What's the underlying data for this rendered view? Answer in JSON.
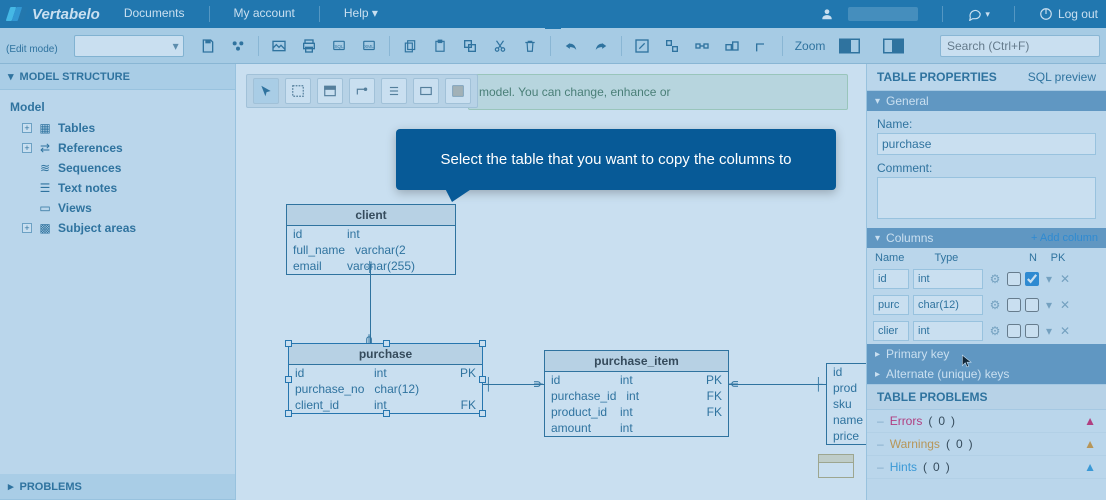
{
  "app": {
    "name": "Vertabelo"
  },
  "topnav": {
    "links": [
      "Documents",
      "My account",
      "Help"
    ],
    "logout": "Log out"
  },
  "mode": {
    "label": "(Edit mode)"
  },
  "zoom": {
    "label": "Zoom"
  },
  "search": {
    "placeholder": "Search (Ctrl+F)"
  },
  "left": {
    "title": "MODEL STRUCTURE",
    "root": "Model",
    "items": [
      {
        "label": "Tables"
      },
      {
        "label": "References"
      },
      {
        "label": "Sequences"
      },
      {
        "label": "Text notes"
      },
      {
        "label": "Views"
      },
      {
        "label": "Subject areas"
      }
    ],
    "problems": "PROBLEMS"
  },
  "canvas": {
    "hint": "model. You can change, enhance or",
    "tooltip": "Select the table that you want to copy the columns to",
    "tables": {
      "client": {
        "name": "client",
        "cols": [
          {
            "name": "id",
            "type": "int",
            "key": ""
          },
          {
            "name": "full_name",
            "type": "varchar(2",
            "key": ""
          },
          {
            "name": "email",
            "type": "varchar(255)",
            "key": ""
          }
        ]
      },
      "purchase": {
        "name": "purchase",
        "cols": [
          {
            "name": "id",
            "type": "int",
            "key": "PK"
          },
          {
            "name": "purchase_no",
            "type": "char(12)",
            "key": ""
          },
          {
            "name": "client_id",
            "type": "int",
            "key": "FK"
          }
        ]
      },
      "purchase_item": {
        "name": "purchase_item",
        "cols": [
          {
            "name": "id",
            "type": "int",
            "key": "PK"
          },
          {
            "name": "purchase_id",
            "type": "int",
            "key": "FK"
          },
          {
            "name": "product_id",
            "type": "int",
            "key": "FK"
          },
          {
            "name": "amount",
            "type": "int",
            "key": ""
          }
        ]
      },
      "product_stub": {
        "cols": [
          "id",
          "prod",
          "sku",
          "name",
          "price"
        ]
      }
    }
  },
  "right": {
    "title": "TABLE PROPERTIES",
    "sql_link": "SQL preview",
    "general": {
      "header": "General",
      "name_label": "Name:",
      "name_value": "purchase",
      "comment_label": "Comment:"
    },
    "columns": {
      "header": "Columns",
      "add": "+ Add column",
      "head": {
        "name": "Name",
        "type": "Type",
        "n": "N",
        "pk": "PK"
      },
      "rows": [
        {
          "name": "id",
          "type": "int",
          "n": false,
          "pk": true
        },
        {
          "name": "purc",
          "type": "char(12)",
          "n": false,
          "pk": false
        },
        {
          "name": "clier",
          "type": "int",
          "n": false,
          "pk": false
        }
      ]
    },
    "primary_key": "Primary key",
    "alternate": "Alternate (unique) keys",
    "problems": {
      "title": "TABLE PROBLEMS",
      "errors": {
        "label": "Errors",
        "count": 0
      },
      "warnings": {
        "label": "Warnings",
        "count": 0
      },
      "hints": {
        "label": "Hints",
        "count": 0
      }
    }
  }
}
